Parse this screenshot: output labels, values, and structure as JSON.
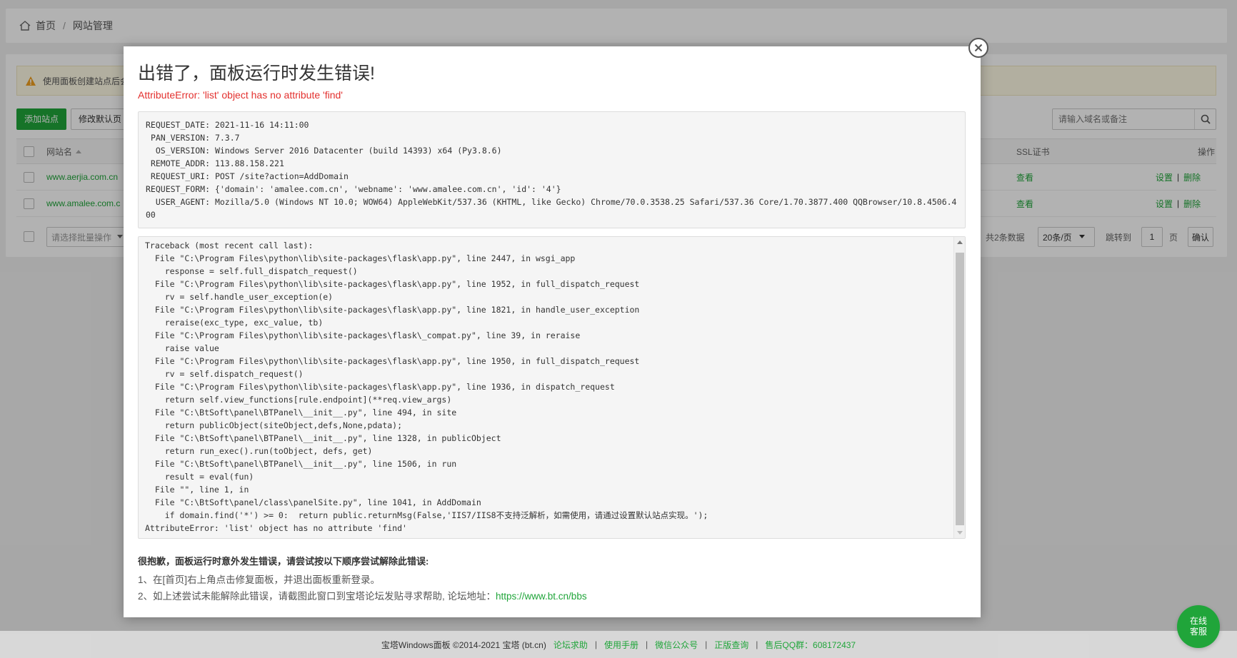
{
  "breadcrumb": {
    "home": "首页",
    "separator": "/",
    "current": "网站管理"
  },
  "notice": {
    "text": "使用面板创建站点后会"
  },
  "toolbar": {
    "add_site": "添加站点",
    "modify_default": "修改默认页"
  },
  "search": {
    "placeholder": "请输入域名或备注"
  },
  "table": {
    "headers": {
      "site_name": "网站名",
      "ssl": "SSL证书",
      "actions": "操作"
    },
    "rows": [
      {
        "name": "www.aerjia.com.cn",
        "ssl": "查看",
        "settings": "设置",
        "sep": "|",
        "delete": "删除"
      },
      {
        "name": "www.amalee.com.c",
        "ssl": "查看",
        "settings": "设置",
        "sep": "|",
        "delete": "删除"
      }
    ]
  },
  "pagination": {
    "batch_placeholder": "请选择批量操作",
    "total": "共2条数据",
    "per_page": "20条/页",
    "jump_to": "跳转到",
    "page_value": "1",
    "page_unit": "页",
    "confirm": "确认"
  },
  "modal": {
    "title": "出错了，面板运行时发生错误!",
    "error": "AttributeError: 'list' object has no attribute 'find'",
    "info_lines": [
      "REQUEST_DATE: 2021-11-16 14:11:00",
      " PAN_VERSION: 7.3.7",
      "  OS_VERSION: Windows Server 2016 Datacenter (build 14393) x64 (Py3.8.6)",
      " REMOTE_ADDR: 113.88.158.221",
      " REQUEST_URI: POST /site?action=AddDomain",
      "REQUEST_FORM: {'domain': 'amalee.com.cn', 'webname': 'www.amalee.com.cn', 'id': '4'}",
      "  USER_AGENT: Mozilla/5.0 (Windows NT 10.0; WOW64) AppleWebKit/537.36 (KHTML, like Gecko) Chrome/70.0.3538.25 Safari/537.36 Core/1.70.3877.400 QQBrowser/10.8.4506.400"
    ],
    "trace_lines": [
      "Traceback (most recent call last):",
      "  File \"C:\\Program Files\\python\\lib\\site-packages\\flask\\app.py\", line 2447, in wsgi_app",
      "    response = self.full_dispatch_request()",
      "  File \"C:\\Program Files\\python\\lib\\site-packages\\flask\\app.py\", line 1952, in full_dispatch_request",
      "    rv = self.handle_user_exception(e)",
      "  File \"C:\\Program Files\\python\\lib\\site-packages\\flask\\app.py\", line 1821, in handle_user_exception",
      "    reraise(exc_type, exc_value, tb)",
      "  File \"C:\\Program Files\\python\\lib\\site-packages\\flask\\_compat.py\", line 39, in reraise",
      "    raise value",
      "  File \"C:\\Program Files\\python\\lib\\site-packages\\flask\\app.py\", line 1950, in full_dispatch_request",
      "    rv = self.dispatch_request()",
      "  File \"C:\\Program Files\\python\\lib\\site-packages\\flask\\app.py\", line 1936, in dispatch_request",
      "    return self.view_functions[rule.endpoint](**req.view_args)",
      "  File \"C:\\BtSoft\\panel\\BTPanel\\__init__.py\", line 494, in site",
      "    return publicObject(siteObject,defs,None,pdata);",
      "  File \"C:\\BtSoft\\panel\\BTPanel\\__init__.py\", line 1328, in publicObject",
      "    return run_exec().run(toObject, defs, get)",
      "  File \"C:\\BtSoft\\panel\\BTPanel\\__init__.py\", line 1506, in run",
      "    result = eval(fun)",
      "  File \"\", line 1, in",
      "  File \"C:\\BtSoft\\panel/class\\panelSite.py\", line 1041, in AddDomain",
      "    if domain.find('*') >= 0:  return public.returnMsg(False,'IIS7/IIS8不支持泛解析，如需使用，请通过设置默认站点实现。');",
      "AttributeError: 'list' object has no attribute 'find'"
    ],
    "help_title": "很抱歉，面板运行时意外发生错误，请尝试按以下顺序尝试解除此错误:",
    "help_1": "1、在[首页]右上角点击修复面板，并退出面板重新登录。",
    "help_2_prefix": "2、如上述尝试未能解除此错误，请截图此窗口到宝塔论坛发贴寻求帮助, 论坛地址：",
    "help_2_link": "https://www.bt.cn/bbs"
  },
  "footer": {
    "copyright": "宝塔Windows面板 ©2014-2021 宝塔 (bt.cn)",
    "links": [
      "论坛求助",
      "使用手册",
      "微信公众号",
      "正版查询",
      "售后QQ群：608172437"
    ],
    "sep": "|"
  },
  "chat": {
    "line1": "在线",
    "line2": "客服"
  },
  "colors": {
    "accent": "#20a53a",
    "error": "#e3302e"
  }
}
